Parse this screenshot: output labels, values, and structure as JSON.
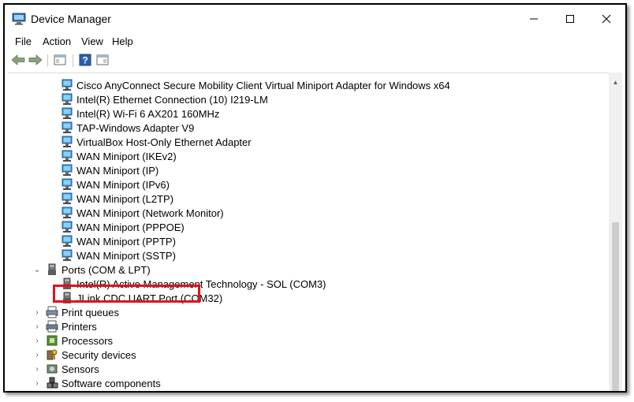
{
  "window": {
    "title": "Device Manager"
  },
  "menu": [
    "File",
    "Action",
    "View",
    "Help"
  ],
  "tree": {
    "network_adapters": [
      "Cisco AnyConnect Secure Mobility Client Virtual Miniport Adapter for Windows x64",
      "Intel(R) Ethernet Connection (10) I219-LM",
      "Intel(R) Wi-Fi 6 AX201 160MHz",
      "TAP-Windows Adapter V9",
      "VirtualBox Host-Only Ethernet Adapter",
      "WAN Miniport (IKEv2)",
      "WAN Miniport (IP)",
      "WAN Miniport (IPv6)",
      "WAN Miniport (L2TP)",
      "WAN Miniport (Network Monitor)",
      "WAN Miniport (PPPOE)",
      "WAN Miniport (PPTP)",
      "WAN Miniport (SSTP)"
    ],
    "ports": {
      "label": "Ports (COM & LPT)",
      "children": [
        "Intel(R) Active Management Technology - SOL (COM3)",
        "JLink CDC UART Port (COM32)"
      ]
    },
    "categories": [
      {
        "label": "Print queues",
        "icon": "print-queue-icon"
      },
      {
        "label": "Printers",
        "icon": "printer-icon"
      },
      {
        "label": "Processors",
        "icon": "processor-icon"
      },
      {
        "label": "Security devices",
        "icon": "security-device-icon"
      },
      {
        "label": "Sensors",
        "icon": "sensor-icon"
      },
      {
        "label": "Software components",
        "icon": "software-component-icon"
      }
    ]
  },
  "colors": {
    "highlight": "#e3111b",
    "network_icon": "#3a8fd6",
    "nav_arrow": "#6a9a5c"
  }
}
